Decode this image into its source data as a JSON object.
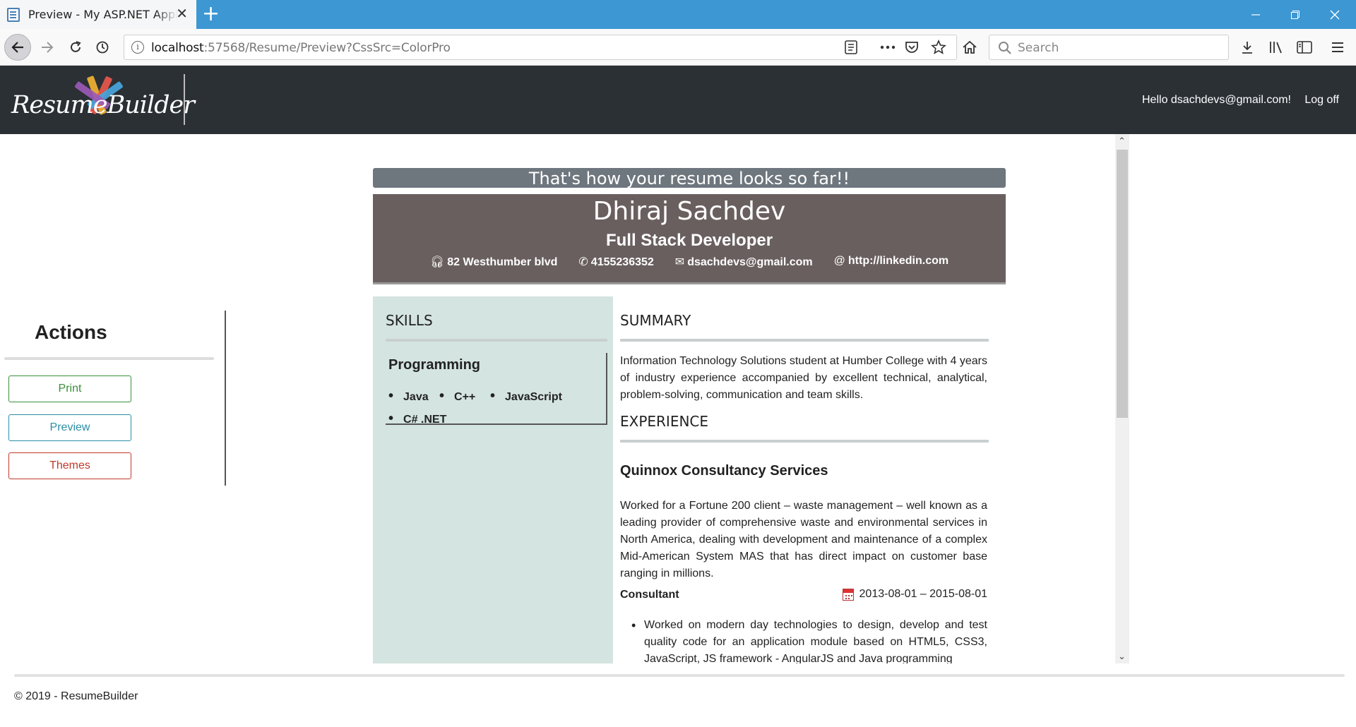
{
  "browser": {
    "tab_title": "Preview - My ASP.NET Application",
    "url_host": "localhost",
    "url_rest": ":57568/Resume/Preview?CssSrc=ColorPro",
    "search_placeholder": "Search"
  },
  "header": {
    "logo_text": "ResumeBuilder",
    "user_greeting": "Hello dsachdevs@gmail.com!",
    "logoff_label": "Log off"
  },
  "actions": {
    "title": "Actions",
    "print_label": "Print",
    "preview_label": "Preview",
    "themes_label": "Themes"
  },
  "preview": {
    "banner": "That's how your resume looks so far!!",
    "name": "Dhiraj Sachdev",
    "job_title": "Full Stack Developer",
    "address": "82 Westhumber blvd",
    "phone": "4155236352",
    "email": "dsachdevs@gmail.com",
    "website": "http://linkedin.com",
    "skills_title": "SKILLS",
    "skill_category": "Programming",
    "skills": [
      "Java",
      "C++",
      "JavaScript",
      "C# .NET"
    ],
    "summary_title": "SUMMARY",
    "summary_text": "Information Technology Solutions student at Humber College with 4 years of industry experience accompanied by excellent technical, analytical, problem-solving, communication and team skills.",
    "experience_title": "EXPERIENCE",
    "company": "Quinnox Consultancy Services",
    "company_desc": "Worked for a Fortune 200 client – waste management – well known as a leading provider of comprehensive waste and environmental services in North America, dealing with development and maintenance of a complex Mid-American System MAS that has direct impact on customer base ranging in millions.",
    "role": "Consultant",
    "dates": "2013-08-01 – 2015-08-01",
    "bullet_1": "Worked on modern day technologies to design, develop and test quality code for an application module based on HTML5, CSS3, JavaScript, JS framework - AngularJS and Java programming"
  },
  "footer": {
    "copyright": "© 2019 - ResumeBuilder"
  },
  "colors": {
    "tabbar": "#3d97d3",
    "site_header": "#2b3035",
    "resume_header": "#6a5f5f",
    "banner": "#6e767e",
    "skills_column": "#d4e4e0",
    "print": "#3b8e3b",
    "preview": "#2a8fa6",
    "themes": "#c0392b"
  }
}
